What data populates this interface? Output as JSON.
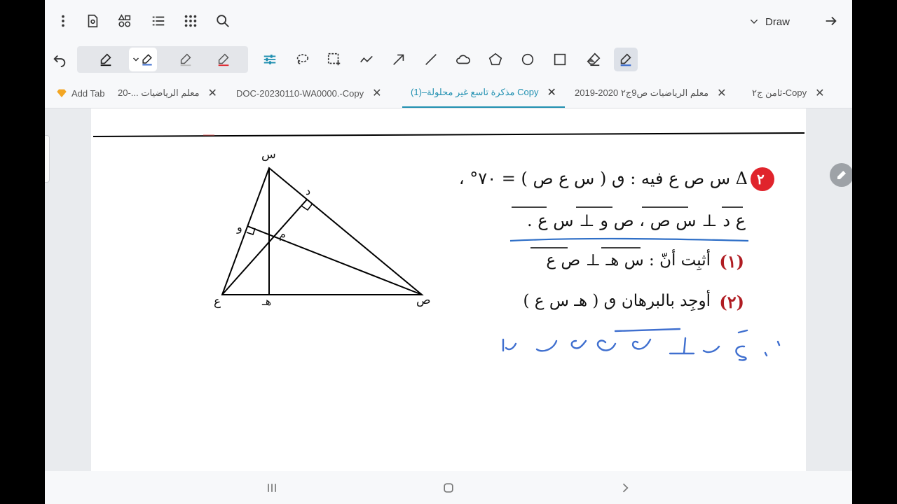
{
  "toolbar": {
    "draw_label": "Draw"
  },
  "tabs": [
    {
      "label": "ثامن ج٢-Copy"
    },
    {
      "label": "معلم الرياضيات ص9ج٢ 2020-2019"
    },
    {
      "label": "مذكرة تاسع غير محلولة–(1) Copy",
      "active": true
    },
    {
      "label": "DOC-20230110-WA0000.-Copy"
    },
    {
      "label": "معلم الرياضيات ...-20"
    }
  ],
  "add_tab_label": "Add Tab",
  "problem": {
    "number": "٢",
    "line1": "Δ س ص ع  فيه :  ٯ ( س ع ص ) = ٧٠° ،",
    "line2": "ع د ⊥ س ص  ،  ص و ⊥ س ع .",
    "q1_num": "(١)",
    "q1": "أثبِت أنّ :  س هـ  ⊥  ص ع",
    "q2_num": "(٢)",
    "q2": "أوجِد بالبرهان  ٯ ( هـ س ع )"
  },
  "figure": {
    "labels": {
      "top": "س",
      "left": "ع",
      "right": "ص",
      "foot": "هـ",
      "d": "د",
      "w": "و",
      "m": "م"
    }
  },
  "colors": {
    "accent": "#1f8fb0",
    "badge": "#e0242c",
    "underline": "#2f6fc7",
    "ink": "#3f6fcf"
  }
}
